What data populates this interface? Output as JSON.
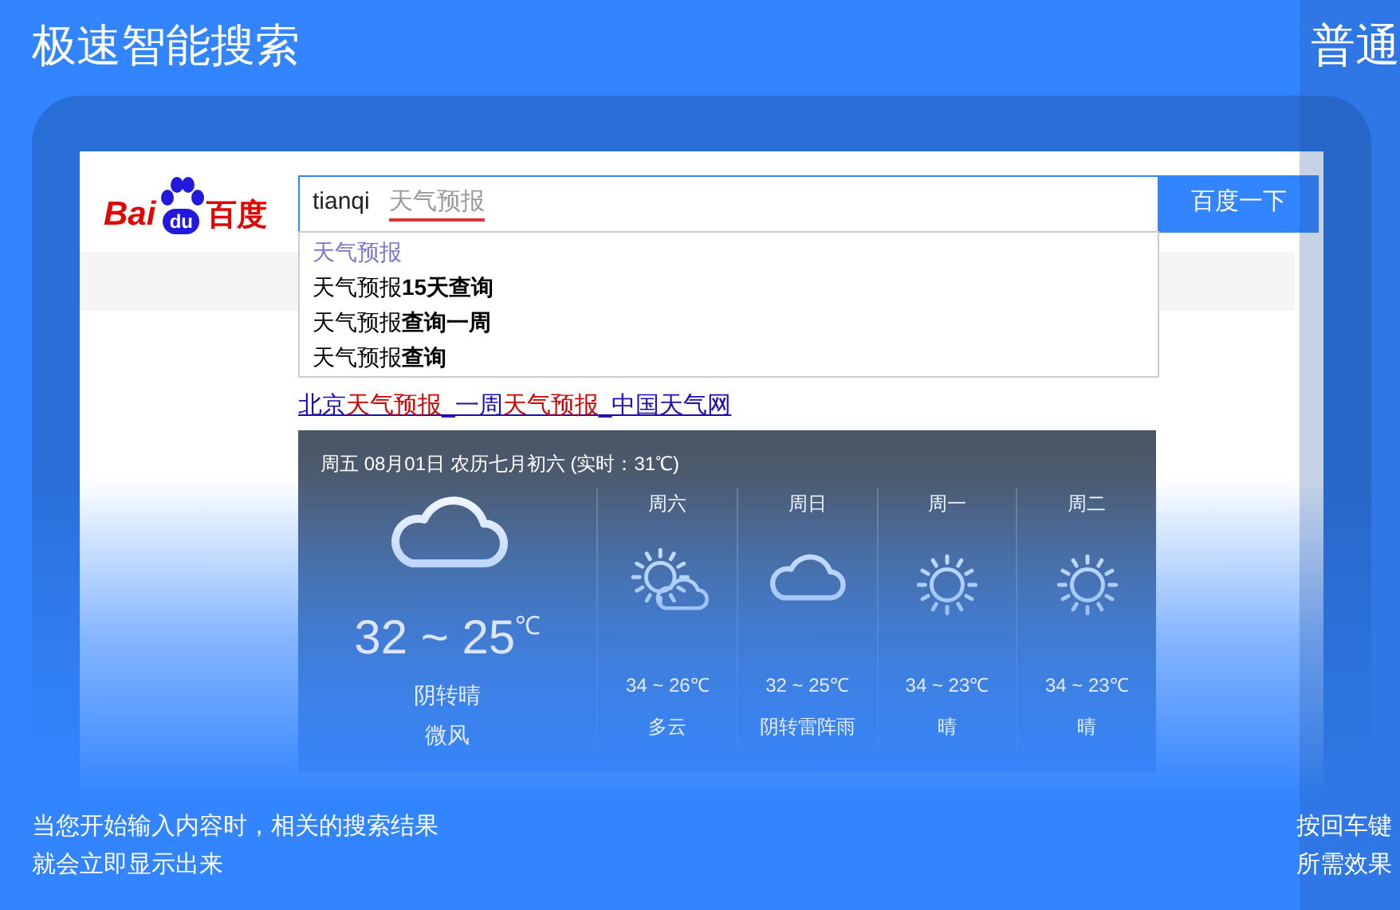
{
  "headline": "极速智能搜索",
  "next_slide": {
    "headline": "普通",
    "caption_lines": [
      "按回车键",
      "所需效果"
    ]
  },
  "logo": {
    "left": "Bai",
    "paw": "du",
    "right": "百度"
  },
  "search": {
    "value": "tianqi",
    "completion": "天气预报",
    "button": "百度一下"
  },
  "suggestions": [
    {
      "text": "天气预报",
      "selected": true
    },
    {
      "text": "天气预报**15天查询**",
      "selected": false
    },
    {
      "text": "天气预报**查询一周**",
      "selected": false
    },
    {
      "text": "天气预报**查询**",
      "selected": false
    }
  ],
  "result_link": [
    {
      "text": "北京",
      "highlight": false
    },
    {
      "text": "天气预报",
      "highlight": true
    },
    {
      "text": "_一周",
      "highlight": false
    },
    {
      "text": "天气预报",
      "highlight": true
    },
    {
      "text": "_中国天气网",
      "highlight": false
    }
  ],
  "weather": {
    "header": "周五 08月01日 农历七月初六 (实时：31℃)",
    "today": {
      "kind": "cloud",
      "temp": "32 ~ 25",
      "unit": "℃",
      "condition": "阴转晴",
      "wind": "微风"
    },
    "forecast": [
      {
        "day": "周六",
        "kind": "sun-cloud",
        "temp": "34 ~ 26℃",
        "condition": "多云"
      },
      {
        "day": "周日",
        "kind": "cloud",
        "temp": "32 ~ 25℃",
        "condition": "阴转雷阵雨"
      },
      {
        "day": "周一",
        "kind": "sun",
        "temp": "34 ~ 23℃",
        "condition": "晴"
      },
      {
        "day": "周二",
        "kind": "sun",
        "temp": "34 ~ 23℃",
        "condition": "晴"
      }
    ]
  },
  "caption_lines": [
    "当您开始输入内容时，相关的搜索结果",
    "就会立即显示出来"
  ]
}
